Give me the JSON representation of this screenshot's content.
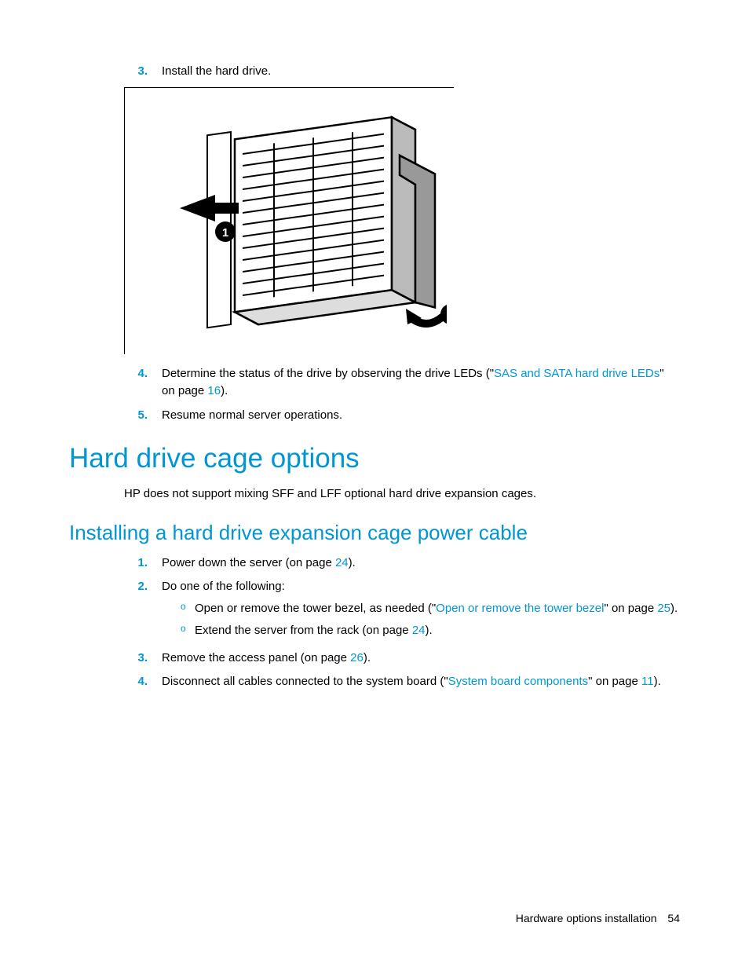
{
  "steps_top": {
    "s3": {
      "num": "3.",
      "text": "Install the hard drive."
    },
    "s4": {
      "num": "4.",
      "pre": "Determine the status of the drive by observing the drive LEDs (\"",
      "link": "SAS and SATA hard drive LEDs",
      "mid": "\" on page ",
      "page": "16",
      "post": ")."
    },
    "s5": {
      "num": "5.",
      "text": "Resume normal server operations."
    }
  },
  "h1": "Hard drive cage options",
  "h1_body": "HP does not support mixing SFF and LFF optional hard drive expansion cages.",
  "h2": "Installing a hard drive expansion cage power cable",
  "steps_bottom": {
    "s1": {
      "num": "1.",
      "pre": "Power down the server (on page ",
      "page": "24",
      "post": ")."
    },
    "s2": {
      "num": "2.",
      "text": "Do one of the following:"
    },
    "s2a": {
      "pre": "Open or remove the tower bezel, as needed (\"",
      "link": "Open or remove the tower bezel",
      "mid": "\" on page ",
      "page": "25",
      "post": ")."
    },
    "s2b": {
      "pre": "Extend the server from the rack (on page ",
      "page": "24",
      "post": ")."
    },
    "s3": {
      "num": "3.",
      "pre": "Remove the access panel (on page ",
      "page": "26",
      "post": ")."
    },
    "s4": {
      "num": "4.",
      "pre": "Disconnect all cables connected to the system board (\"",
      "link": "System board components",
      "mid": "\" on page ",
      "page": "11",
      "post": ")."
    }
  },
  "footer": {
    "section": "Hardware options installation",
    "page": "54"
  },
  "sub_bullet": "o"
}
